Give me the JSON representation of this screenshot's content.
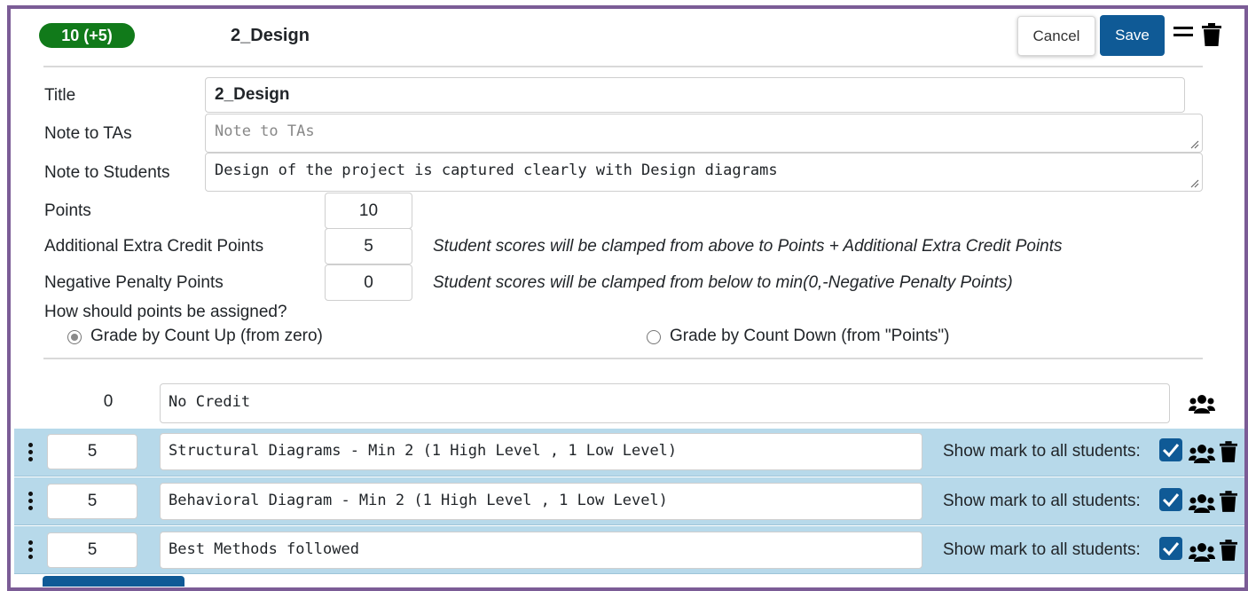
{
  "header": {
    "score_badge": "10 (+5)",
    "title": "2_Design",
    "cancel_label": "Cancel",
    "save_label": "Save"
  },
  "form": {
    "title_label": "Title",
    "title_value": "2_Design",
    "note_tas_label": "Note to TAs",
    "note_tas_placeholder": "Note to TAs",
    "note_students_label": "Note to Students",
    "note_students_value": "Design of the project is captured clearly with Design diagrams",
    "points_label": "Points",
    "points_value": "10",
    "extra_label": "Additional Extra Credit Points",
    "extra_value": "5",
    "extra_hint": "Student scores will be clamped from above to Points + Additional Extra Credit Points",
    "penalty_label": "Negative Penalty Points",
    "penalty_value": "0",
    "penalty_hint": "Student scores will be clamped from below to min(0,-Negative Penalty Points)",
    "assign_question": "How should points be assigned?",
    "option_up": "Grade by Count Up (from zero)",
    "option_down": "Grade by Count Down (from \"Points\")",
    "selected_option": "up"
  },
  "no_credit": {
    "points": "0",
    "description": "No Credit"
  },
  "items": [
    {
      "points": "5",
      "description": "Structural Diagrams - Min 2 (1 High Level , 1 Low Level)",
      "show_label": "Show mark to all students:",
      "checked": true
    },
    {
      "points": "5",
      "description": "Behavioral Diagram - Min 2 (1 High Level , 1 Low Level)",
      "show_label": "Show mark to all students:",
      "checked": true
    },
    {
      "points": "5",
      "description": "Best Methods followed",
      "show_label": "Show mark to all students:",
      "checked": true
    }
  ],
  "colors": {
    "badge": "#117a1a",
    "primary": "#0f5a96",
    "row_bg": "#b7d9ea",
    "frame": "#7b5c96"
  },
  "icons": {
    "menu": "hamburger-icon",
    "delete": "trash-icon",
    "group": "users-icon",
    "drag": "kebab-icon",
    "check": "checkbox-checked-icon"
  }
}
